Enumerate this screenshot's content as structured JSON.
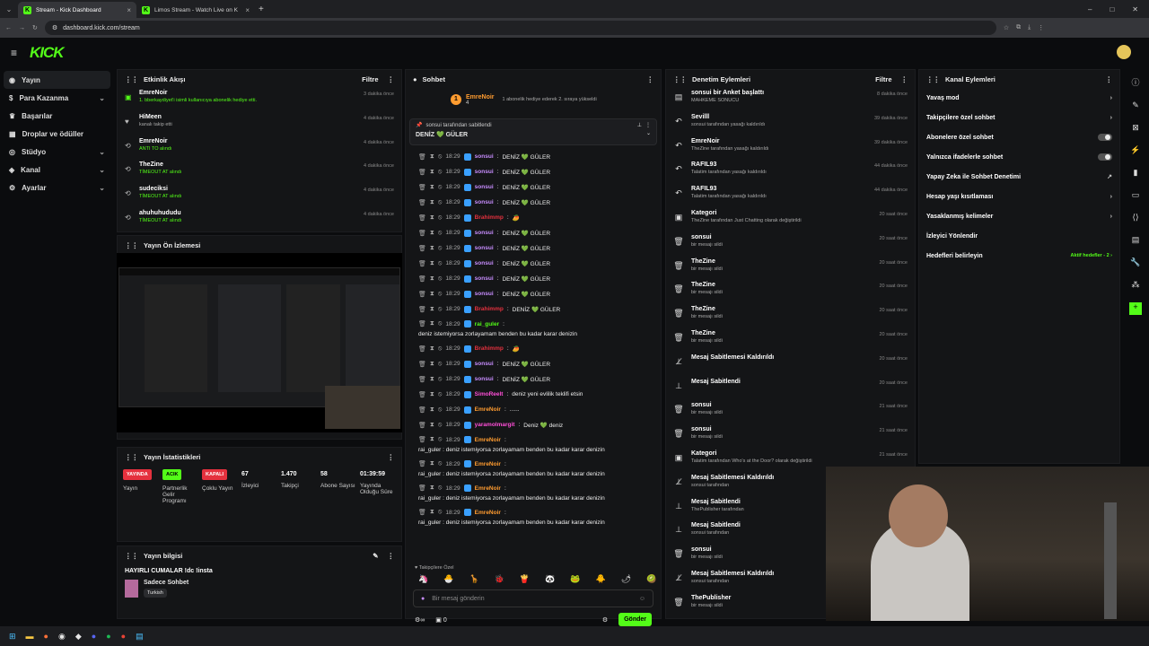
{
  "browser": {
    "tabs": [
      {
        "title": "Stream - Kick Dashboard"
      },
      {
        "title": "Limos Stream - Watch Live on K"
      }
    ],
    "url": "dashboard.kick.com/stream"
  },
  "brand": "KICK",
  "sidebar": {
    "items": [
      {
        "label": "Yayın",
        "icon": "broadcast-icon"
      },
      {
        "label": "Para Kazanma",
        "icon": "dollar-icon"
      },
      {
        "label": "Başarılar",
        "icon": "trophy-icon"
      },
      {
        "label": "Droplar ve ödüller",
        "icon": "gift-icon"
      },
      {
        "label": "Stüdyo",
        "icon": "studio-icon"
      },
      {
        "label": "Kanal",
        "icon": "channel-icon"
      },
      {
        "label": "Ayarlar",
        "icon": "gear-icon"
      }
    ]
  },
  "activity": {
    "title": "Etkinlik Akışı",
    "filter": "Filtre",
    "items": [
      {
        "name": "EmreNoir",
        "sub": "1. bberkaydiyet'i isimli kullanıcıya abonelik hediye etti.",
        "time": "3 dakika önce",
        "icon": "gift-icon"
      },
      {
        "name": "HiMeen",
        "sub": "kanalı takip etti",
        "time": "4 dakika önce",
        "icon": "heart-icon"
      },
      {
        "name": "EmreNoir",
        "sub": "ANTI TO alındı",
        "time": "4 dakika önce",
        "icon": "share-icon"
      },
      {
        "name": "TheZine",
        "sub": "TİMEOUT AT alındı",
        "time": "4 dakika önce",
        "icon": "share-icon"
      },
      {
        "name": "sudeciksi",
        "sub": "TİMEOUT AT alındı",
        "time": "4 dakika önce",
        "icon": "share-icon"
      },
      {
        "name": "ahuhuhududu",
        "sub": "TİMEOUT AT alındı",
        "time": "4 dakika önce",
        "icon": "share-icon"
      }
    ]
  },
  "preview": {
    "title": "Yayın Ön İzlemesi"
  },
  "stats": {
    "title": "Yayın İstatistikleri",
    "items": [
      {
        "badge": "YAYINDA",
        "label": "Yayın",
        "type": "red"
      },
      {
        "badge": "ACIK",
        "label": "Partnerlik Gelir Programı",
        "type": "green"
      },
      {
        "badge": "KAPALI",
        "label": "Çoklu Yayın",
        "type": "red"
      },
      {
        "value": "67",
        "label": "İzleyici"
      },
      {
        "value": "1.470",
        "label": "Takipçi"
      },
      {
        "value": "58",
        "label": "Abone Sayısı"
      },
      {
        "value": "01:39:59",
        "label": "Yayında Olduğu Süre"
      }
    ]
  },
  "info": {
    "title": "Yayın bilgisi",
    "stream_title": "HAYIRLI CUMALAR !dc !insta",
    "category": "Sadece Sohbet",
    "tag": "Turkish"
  },
  "chat": {
    "title": "Sohbet",
    "top_user": "EmreNoir",
    "top_count": "4",
    "top_note": "1 abonelik hediye ederek 2. sıraya yükseldi",
    "pinned_by": "sonsui tarafından sabitlendi",
    "pinned_msg": "DENİZ 💚 GÜLER",
    "lines": [
      {
        "time": "18:29",
        "user": "sonsui",
        "color": "u-pur",
        "msg": "DENİZ 💚 GÜLER"
      },
      {
        "time": "18:29",
        "user": "sonsui",
        "color": "u-pur",
        "msg": "DENİZ 💚 GÜLER"
      },
      {
        "time": "18:29",
        "user": "sonsui",
        "color": "u-pur",
        "msg": "DENİZ 💚 GÜLER"
      },
      {
        "time": "18:29",
        "user": "sonsui",
        "color": "u-pur",
        "msg": "DENİZ 💚 GÜLER"
      },
      {
        "time": "18:29",
        "user": "Brahimmp",
        "color": "u-red",
        "msg": "🥭"
      },
      {
        "time": "18:29",
        "user": "sonsui",
        "color": "u-pur",
        "msg": "DENİZ 💚 GÜLER"
      },
      {
        "time": "18:29",
        "user": "sonsui",
        "color": "u-pur",
        "msg": "DENİZ 💚 GÜLER"
      },
      {
        "time": "18:29",
        "user": "sonsui",
        "color": "u-pur",
        "msg": "DENİZ 💚 GÜLER"
      },
      {
        "time": "18:29",
        "user": "sonsui",
        "color": "u-pur",
        "msg": "DENİZ 💚 GÜLER"
      },
      {
        "time": "18:29",
        "user": "sonsui",
        "color": "u-pur",
        "msg": "DENİZ 💚 GÜLER"
      },
      {
        "time": "18:29",
        "user": "Brahimmp",
        "color": "u-red",
        "msg": "DENİZ 💚 GÜLER"
      },
      {
        "time": "18:29",
        "user": "rai_guler",
        "color": "u-grn",
        "msg": "deniz istemiyorsa zorlayamam benden bu kadar karar denizin"
      },
      {
        "time": "18:29",
        "user": "Brahimmp",
        "color": "u-red",
        "msg": "🥭"
      },
      {
        "time": "18:29",
        "user": "sonsui",
        "color": "u-pur",
        "msg": "DENİZ 💚 GÜLER"
      },
      {
        "time": "18:29",
        "user": "sonsui",
        "color": "u-pur",
        "msg": "DENİZ 💚 GÜLER"
      },
      {
        "time": "18:29",
        "user": "SimoReelt",
        "color": "u-pink",
        "msg": "deniz yeni evlilik teklifi etsin"
      },
      {
        "time": "18:29",
        "user": "EmreNoir",
        "color": "u-org",
        "msg": "......"
      },
      {
        "time": "18:29",
        "user": "yaramolmargit",
        "color": "u-pink",
        "msg": "Deniz 💚 deniz"
      },
      {
        "time": "18:29",
        "user": "EmreNoir",
        "color": "u-org",
        "msg": "rai_guler : deniz istemiyorsa zorlayamam benden bu kadar karar denizin"
      },
      {
        "time": "18:29",
        "user": "EmreNoir",
        "color": "u-org",
        "msg": "rai_guler : deniz istemiyorsa zorlayamam benden bu kadar karar denizin"
      },
      {
        "time": "18:29",
        "user": "EmreNoir",
        "color": "u-org",
        "msg": "rai_guler : deniz istemiyorsa zorlayamam benden bu kadar karar denizin"
      },
      {
        "time": "18:29",
        "user": "EmreNoir",
        "color": "u-org",
        "msg": "rai_guler : deniz istemiyorsa zorlayamam benden bu kadar karar denizin"
      }
    ],
    "followers_label": "Takipçilere Özel",
    "placeholder": "Bir mesaj gönderin",
    "count": "0",
    "send": "Gönder"
  },
  "mod": {
    "title": "Denetim Eylemleri",
    "filter": "Filtre",
    "items": [
      {
        "title": "sonsui bir Anket başlattı",
        "desc": "MAHKEME SONUCU",
        "time": "8 dakika önce",
        "icon": "poll-icon"
      },
      {
        "title": "Sevilll",
        "desc": "sonsui tarafından yasağı kaldırıldı",
        "time": "39 dakika önce",
        "icon": "undo-icon"
      },
      {
        "title": "EmreNoir",
        "desc": "TheZine tarafından yasağı kaldırıldı",
        "time": "39 dakika önce",
        "icon": "undo-icon"
      },
      {
        "title": "RAFIL93",
        "desc": "Talatim tarafından yasağı kaldırıldı",
        "time": "44 dakika önce",
        "icon": "undo-icon"
      },
      {
        "title": "RAFIL93",
        "desc": "Talatim tarafından yasağı kaldırıldı",
        "time": "44 dakika önce",
        "icon": "undo-icon"
      },
      {
        "title": "Kategori",
        "desc": "TheZine tarafından Just Chatting olarak değiştirildi",
        "time": "20 saat önce",
        "icon": "category-icon"
      },
      {
        "title": "sonsui",
        "desc": "bir mesajı sildi",
        "time": "20 saat önce",
        "icon": "trash-icon"
      },
      {
        "title": "TheZine",
        "desc": "bir mesajı sildi",
        "time": "20 saat önce",
        "icon": "trash-icon"
      },
      {
        "title": "TheZine",
        "desc": "bir mesajı sildi",
        "time": "20 saat önce",
        "icon": "trash-icon"
      },
      {
        "title": "TheZine",
        "desc": "bir mesajı sildi",
        "time": "20 saat önce",
        "icon": "trash-icon"
      },
      {
        "title": "TheZine",
        "desc": "bir mesajı sildi",
        "time": "20 saat önce",
        "icon": "trash-icon"
      },
      {
        "title": "Mesaj Sabitlemesi Kaldırıldı",
        "desc": "",
        "time": "20 saat önce",
        "icon": "unpin-icon"
      },
      {
        "title": "Mesaj Sabitlendi",
        "desc": "",
        "time": "20 saat önce",
        "icon": "pin-icon"
      },
      {
        "title": "sonsui",
        "desc": "bir mesajı sildi",
        "time": "21 saat önce",
        "icon": "trash-icon"
      },
      {
        "title": "sonsui",
        "desc": "bir mesajı sildi",
        "time": "21 saat önce",
        "icon": "trash-icon"
      },
      {
        "title": "Kategori",
        "desc": "Talatim tarafından Who's at the Door? olarak değiştirildi",
        "time": "21 saat önce",
        "icon": "category-icon"
      },
      {
        "title": "Mesaj Sabitlemesi Kaldırıldı",
        "desc": "sonsui tarafından",
        "time": "",
        "icon": "unpin-icon"
      },
      {
        "title": "Mesaj Sabitlendi",
        "desc": "ThePublisher tarafından",
        "time": "",
        "icon": "pin-icon"
      },
      {
        "title": "Mesaj Sabitlendi",
        "desc": "sonsui tarafından",
        "time": "",
        "icon": "pin-icon"
      },
      {
        "title": "sonsui",
        "desc": "bir mesajı sildi",
        "time": "",
        "icon": "trash-icon"
      },
      {
        "title": "Mesaj Sabitlemesi Kaldırıldı",
        "desc": "sonsui tarafından",
        "time": "",
        "icon": "unpin-icon"
      },
      {
        "title": "ThePublisher",
        "desc": "bir mesajı sildi",
        "time": "",
        "icon": "trash-icon"
      }
    ]
  },
  "channel": {
    "title": "Kanal Eylemleri",
    "items": [
      {
        "label": "Yavaş mod",
        "right": "›"
      },
      {
        "label": "Takipçilere özel sohbet",
        "right": "›"
      },
      {
        "label": "Abonelere özel sohbet",
        "right": "toggle"
      },
      {
        "label": "Yalnızca ifadelerle sohbet",
        "right": "toggle"
      },
      {
        "label": "Yapay Zeka ile Sohbet Denetimi",
        "right": "↗"
      },
      {
        "label": "Hesap yaşı kısıtlaması",
        "right": "›"
      },
      {
        "label": "Yasaklanmış kelimeler",
        "right": "›"
      },
      {
        "label": "İzleyici Yönlendir",
        "right": ""
      },
      {
        "label": "Hedefleri belirleyin",
        "right": "Aktif hedefler - 2  ›"
      }
    ]
  }
}
